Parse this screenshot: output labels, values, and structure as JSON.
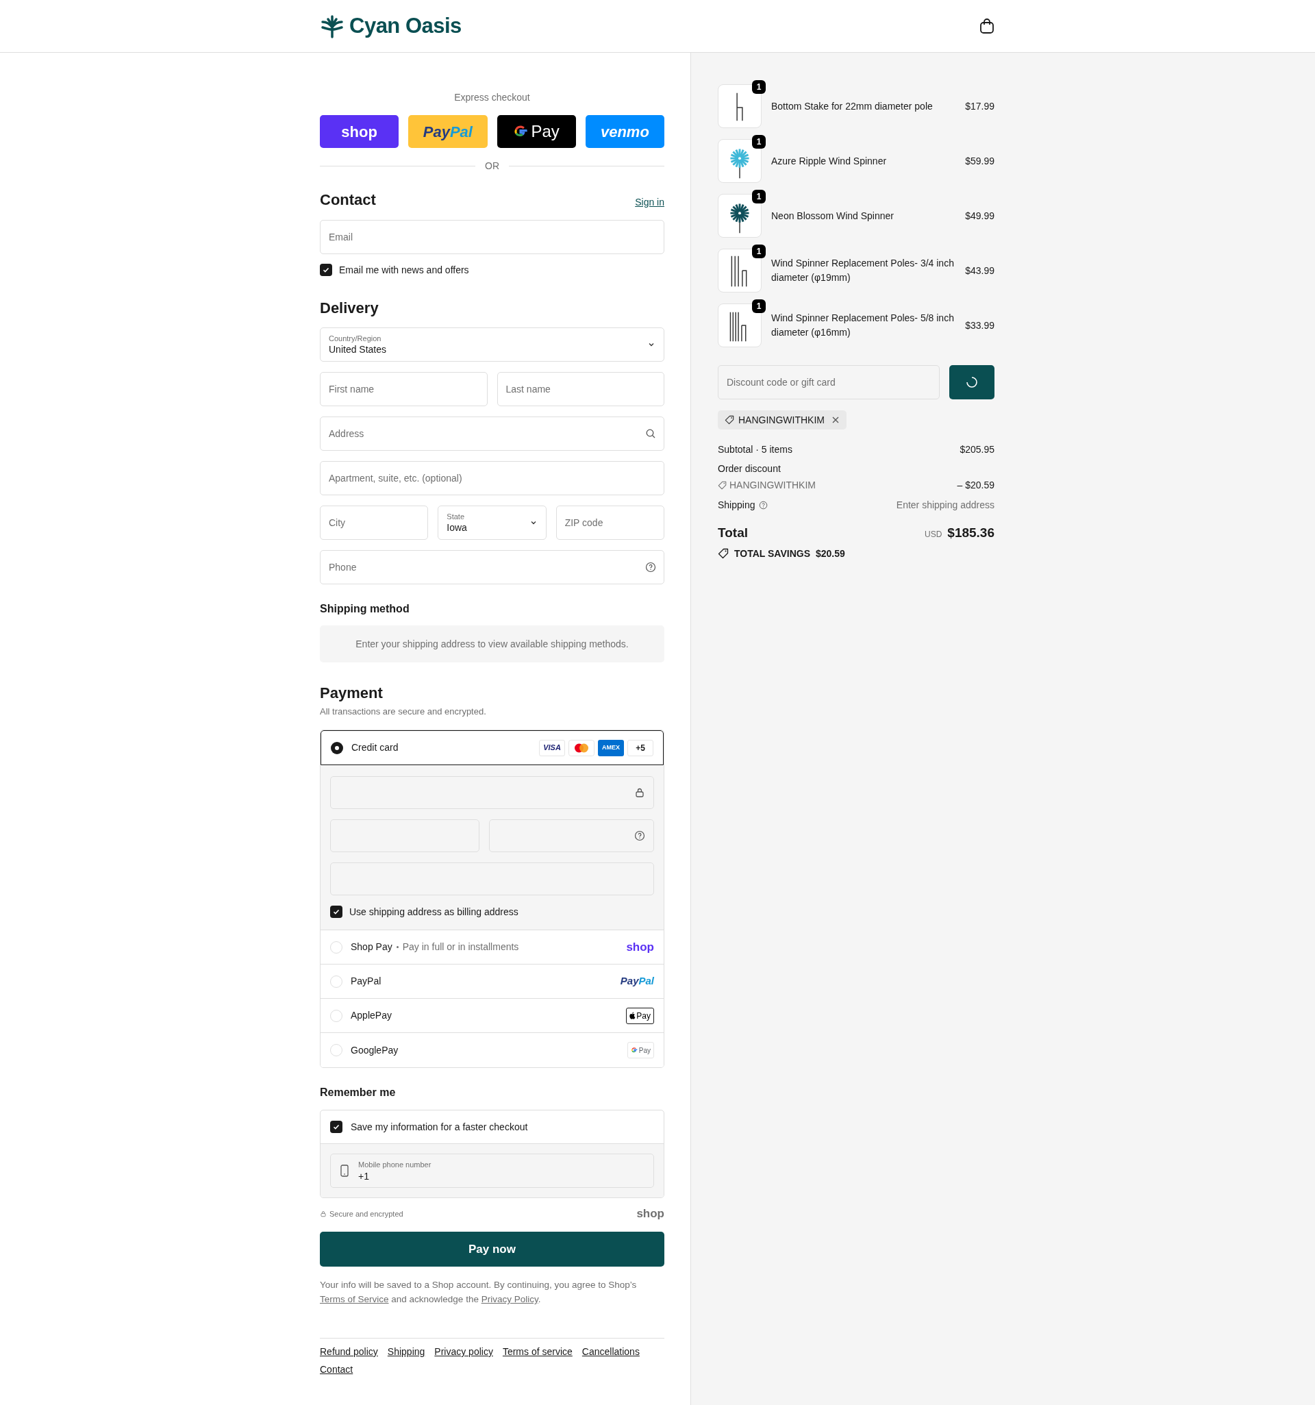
{
  "header": {
    "brand": "Cyan Oasis"
  },
  "express_checkout": {
    "label": "Express checkout",
    "divider": "OR",
    "buttons": [
      {
        "kind": "shop",
        "parts": [
          "shop"
        ]
      },
      {
        "kind": "paypal",
        "parts": [
          "Pay",
          "Pal"
        ]
      },
      {
        "kind": "gpay",
        "parts": [
          "Pay"
        ]
      },
      {
        "kind": "venmo",
        "parts": [
          "venmo"
        ]
      }
    ]
  },
  "contact": {
    "title": "Contact",
    "sign_in": "Sign in",
    "email": {
      "placeholder": "Email"
    },
    "news": {
      "label": "Email me with news and offers",
      "checked": true
    }
  },
  "delivery": {
    "title": "Delivery",
    "country": {
      "label": "Country/Region",
      "value": "United States"
    },
    "first_name": {
      "placeholder": "First name"
    },
    "last_name": {
      "placeholder": "Last name"
    },
    "address": {
      "placeholder": "Address"
    },
    "apartment": {
      "placeholder": "Apartment, suite, etc. (optional)"
    },
    "city": {
      "placeholder": "City"
    },
    "state": {
      "label": "State",
      "value": "Iowa"
    },
    "zip": {
      "placeholder": "ZIP code"
    },
    "phone": {
      "placeholder": "Phone"
    }
  },
  "shipping_method": {
    "title": "Shipping method",
    "notice": "Enter your shipping address to view available shipping methods."
  },
  "payment": {
    "title": "Payment",
    "subtitle": "All transactions are secure and encrypted.",
    "card_brands": [
      {
        "kind": "visa",
        "label": "VISA"
      },
      {
        "kind": "mastercard"
      },
      {
        "kind": "amex",
        "label": "AMEX"
      },
      {
        "kind": "more",
        "label": "+5"
      }
    ],
    "billing_same": {
      "label": "Use shipping address as billing address",
      "checked": true
    },
    "methods": [
      {
        "kind": "card",
        "label": "Credit card",
        "selected": true
      },
      {
        "kind": "shop",
        "label": "Shop Pay",
        "detail": "Pay in full or in installments",
        "logo": [
          "shop"
        ],
        "selected": false
      },
      {
        "kind": "paypal",
        "label": "PayPal",
        "logo": [
          "Pay",
          "Pal"
        ],
        "selected": false
      },
      {
        "kind": "applepay",
        "label": "ApplePay",
        "logo": [
          "Pay"
        ],
        "selected": false
      },
      {
        "kind": "googlepay",
        "label": "GooglePay",
        "logo": [
          "Pay"
        ],
        "selected": false
      }
    ]
  },
  "remember_me": {
    "title": "Remember me",
    "save": {
      "label": "Save my information for a faster checkout",
      "checked": true
    },
    "phone": {
      "label": "Mobile phone number",
      "value": "+1"
    }
  },
  "secure_note": "Secure and encrypted",
  "shop_logo": "shop",
  "pay_button": "Pay now",
  "legal": {
    "before": "Your info will be saved to a Shop account. By continuing, you agree to Shop’s",
    "link1": "Terms of Service",
    "middle": "and acknowledge the",
    "link2": "Privacy Policy",
    "after": "."
  },
  "footer_links": [
    "Refund policy",
    "Shipping",
    "Privacy policy",
    "Terms of service",
    "Cancellations",
    "Contact"
  ],
  "order_summary": {
    "items": [
      {
        "kind": "stake",
        "quantity": "1",
        "name": "Bottom Stake for 22mm diameter pole",
        "price": "$17.99"
      },
      {
        "kind": "spinner_light",
        "quantity": "1",
        "name": "Azure Ripple Wind Spinner",
        "price": "$59.99"
      },
      {
        "kind": "spinner_dark",
        "quantity": "1",
        "name": "Neon Blossom Wind Spinner",
        "price": "$49.99"
      },
      {
        "kind": "poles_three",
        "quantity": "1",
        "name": "Wind Spinner Replacement Poles- 3/4 inch diameter (φ19mm)",
        "price": "$43.99"
      },
      {
        "kind": "poles_four",
        "quantity": "1",
        "name": "Wind Spinner Replacement Poles- 5/8 inch diameter (φ16mm)",
        "price": "$33.99"
      }
    ],
    "discount": {
      "placeholder": "Discount code or gift card"
    },
    "applied_code": "HANGINGWITHKIM",
    "subtotal": {
      "label": "Subtotal · 5 items",
      "value": "$205.95"
    },
    "order_discount": {
      "label": "Order discount",
      "code": "HANGINGWITHKIM",
      "value": "– $20.59"
    },
    "shipping": {
      "label": "Shipping",
      "value": "Enter shipping address"
    },
    "total": {
      "label": "Total",
      "currency": "USD",
      "value": "$185.36"
    },
    "savings": {
      "label": "TOTAL SAVINGS",
      "value": "$20.59"
    }
  }
}
